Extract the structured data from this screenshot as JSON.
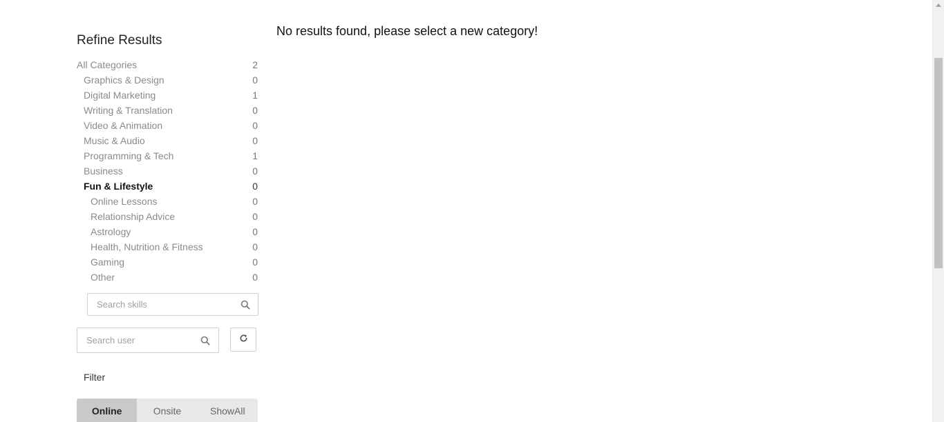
{
  "sidebar": {
    "title": "Refine Results",
    "categories": [
      {
        "label": "All Categories",
        "count": "2"
      },
      {
        "label": "Graphics & Design",
        "count": "0"
      },
      {
        "label": "Digital Marketing",
        "count": "1"
      },
      {
        "label": "Writing & Translation",
        "count": "0"
      },
      {
        "label": "Video & Animation",
        "count": "0"
      },
      {
        "label": "Music & Audio",
        "count": "0"
      },
      {
        "label": "Programming & Tech",
        "count": "1"
      },
      {
        "label": "Business",
        "count": "0"
      },
      {
        "label": "Fun & Lifestyle",
        "count": "0"
      },
      {
        "label": "Online Lessons",
        "count": "0"
      },
      {
        "label": "Relationship Advice",
        "count": "0"
      },
      {
        "label": "Astrology",
        "count": "0"
      },
      {
        "label": "Health, Nutrition & Fitness",
        "count": "0"
      },
      {
        "label": "Gaming",
        "count": "0"
      },
      {
        "label": "Other",
        "count": "0"
      }
    ],
    "skills_search": {
      "placeholder": "Search skills",
      "value": ""
    },
    "user_search": {
      "placeholder": "Search user",
      "value": ""
    },
    "filter": {
      "label": "Filter",
      "options": [
        "Online",
        "Onsite",
        "ShowAll"
      ],
      "selected": "Online"
    }
  },
  "main": {
    "message": "No results found, please select a new category!"
  },
  "icons": {
    "search": "search-icon",
    "refresh": "refresh-icon"
  }
}
